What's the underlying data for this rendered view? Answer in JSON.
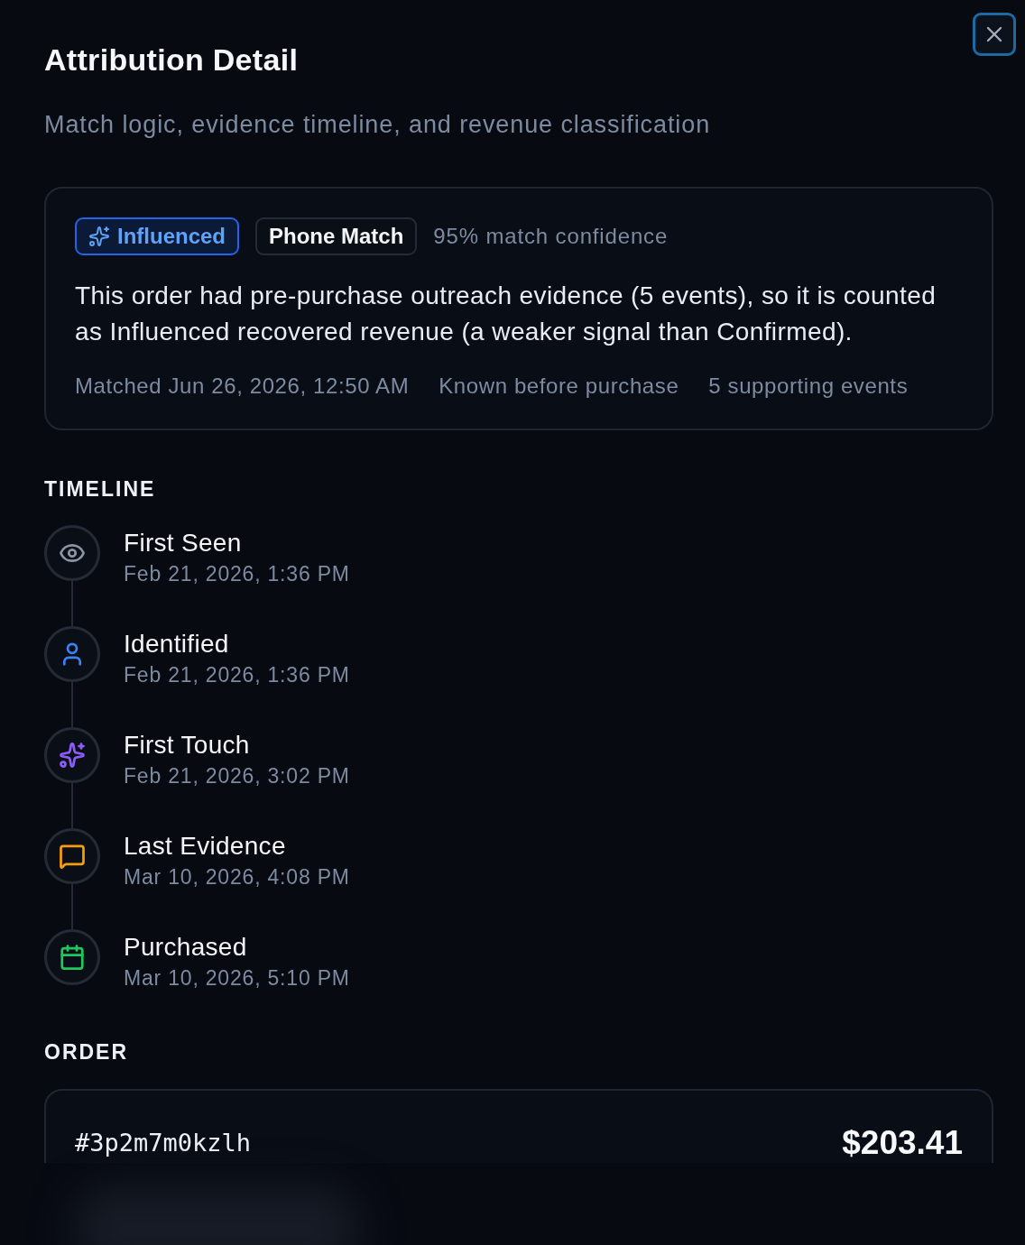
{
  "dialog": {
    "title": "Attribution Detail",
    "subtitle": "Match logic, evidence timeline, and revenue classification"
  },
  "summary": {
    "badges": [
      {
        "kind": "classification",
        "label": "Influenced"
      },
      {
        "kind": "match",
        "label": "Phone Match"
      }
    ],
    "confidence": "95% match confidence",
    "explanation": "This order had pre-purchase outreach evidence (5 events), so it is counted as Influenced recovered revenue (a weaker signal than Confirmed).",
    "meta": [
      "Matched Jun 26, 2026, 12:50 AM",
      "Known before purchase",
      "5 supporting events"
    ]
  },
  "timeline": {
    "heading": "TIMELINE",
    "events": [
      {
        "kind": "seen",
        "title": "First Seen",
        "time": "Feb 21, 2026, 1:36 PM",
        "color": "#8a95a6"
      },
      {
        "kind": "identified",
        "title": "Identified",
        "time": "Feb 21, 2026, 1:36 PM",
        "color": "#3b82f6"
      },
      {
        "kind": "touch",
        "title": "First Touch",
        "time": "Feb 21, 2026, 3:02 PM",
        "color": "#8b5cf6"
      },
      {
        "kind": "evidence",
        "title": "Last Evidence",
        "time": "Mar 10, 2026, 4:08 PM",
        "color": "#f59e0b"
      },
      {
        "kind": "purchase",
        "title": "Purchased",
        "time": "Mar 10, 2026, 5:10 PM",
        "color": "#22c55e"
      }
    ]
  },
  "order": {
    "heading": "ORDER",
    "order_id": "#3p2m7m0kzlh",
    "total": "$203.41"
  }
}
